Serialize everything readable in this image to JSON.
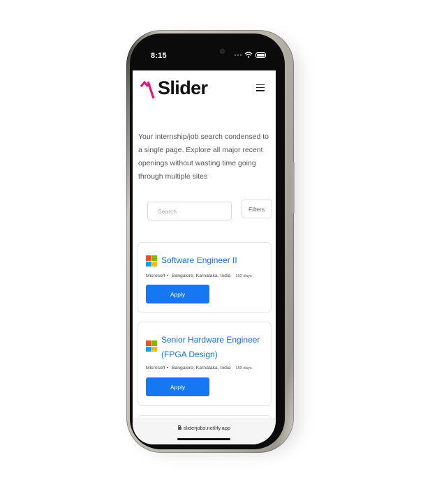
{
  "status_bar": {
    "time": "8:15"
  },
  "header": {
    "logo_mark": "^\\",
    "logo_text": "Slider",
    "menu_icon": "hamburger-menu-icon"
  },
  "tagline": "Your internship/job search condensed to a single page. Explore all major recent openings without wasting time going through multiple sites",
  "search": {
    "placeholder": "Search",
    "value": "",
    "filters_label": "Filters"
  },
  "jobs": [
    {
      "title": "Software Engineer II",
      "company": "Microsoft",
      "separator": "•",
      "location": "Bangalore, Karnataka, India",
      "age": "102 days",
      "apply_label": "Apply"
    },
    {
      "title": "Senior Hardware Engineer (FPGA Design)",
      "company": "Microsoft",
      "separator": "•",
      "location": "Bangalore, Karnataka, India",
      "age": "150 days",
      "apply_label": "Apply"
    }
  ],
  "browser": {
    "url": "sliderjobs.netlify.app"
  },
  "colors": {
    "accent": "#1677f2",
    "logo_mark": "#e6127a",
    "title_link": "#1a6fe0",
    "ms_red": "#f25022",
    "ms_green": "#7fba00",
    "ms_blue": "#00a4ef",
    "ms_yellow": "#ffb900"
  }
}
